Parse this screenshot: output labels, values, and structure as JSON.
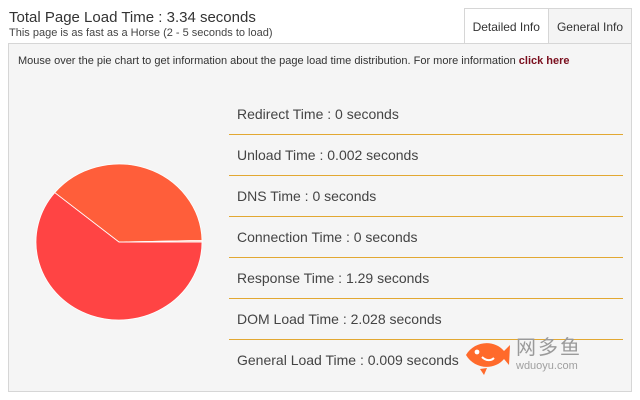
{
  "header": {
    "title": "Total Page Load Time : 3.34 seconds",
    "subtitle": "This page is as fast as a Horse (2 - 5 seconds to load)"
  },
  "tabs": [
    {
      "label": "Detailed Info",
      "active": true
    },
    {
      "label": "General Info",
      "active": false
    }
  ],
  "panel": {
    "info_text": "Mouse over the pie chart to get information about the page load time distribution. For more information ",
    "info_link": "click here"
  },
  "metrics": [
    {
      "label": "Redirect Time : 0 seconds"
    },
    {
      "label": "Unload Time : 0.002 seconds"
    },
    {
      "label": "DNS Time : 0 seconds"
    },
    {
      "label": "Connection Time : 0 seconds"
    },
    {
      "label": "Response Time : 1.29 seconds"
    },
    {
      "label": "DOM Load Time : 2.028 seconds"
    },
    {
      "label": "General Load Time : 0.009 seconds"
    }
  ],
  "pie": {
    "slices": [
      {
        "value": 2.028,
        "color": "#ff4444"
      },
      {
        "value": 1.29,
        "color": "#ff5e3a"
      },
      {
        "value": 0.009,
        "color": "#ff8a5c"
      },
      {
        "value": 0.002,
        "color": "#ffffff"
      }
    ]
  },
  "colors": {
    "divider": "#e2a832",
    "link": "#7a0f1e",
    "panel_bg": "#f5f5f5"
  },
  "watermark": {
    "icon": "fish-logo",
    "cn_text": "网多鱼",
    "en_text": "wduoyu.com"
  }
}
